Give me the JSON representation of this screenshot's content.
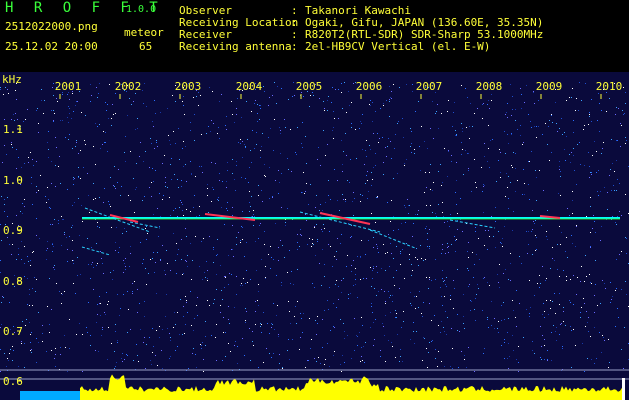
{
  "header": {
    "logo": "H R O F F T",
    "version": "1.0.0",
    "filename": "2512022000.png",
    "datetime": "25.12.02 20:00",
    "meteor_label": "meteor",
    "meteor_count": "65",
    "info": [
      {
        "label": "Observer",
        "value": "Takanori Kawachi"
      },
      {
        "label": "Receiving Location",
        "value": "Ogaki, Gifu, JAPAN (136.60E, 35.35N)"
      },
      {
        "label": "Receiver",
        "value": "R820T2(RTL-SDR) SDR-Sharp 53.1000MHz"
      },
      {
        "label": "Receiving antenna",
        "value": "2el-HB9CV Vertical (el. E-W)"
      }
    ]
  },
  "spectrogram": {
    "unit_label": "kHz",
    "time_ticks": [
      "2001",
      "2002",
      "2003",
      "2004",
      "2005",
      "2006",
      "2007",
      "2008",
      "2009",
      "2010"
    ],
    "freq_ticks": [
      "1.1",
      "1.0",
      "0.9",
      "0.8",
      "0.7",
      "0.6"
    ],
    "colors": {
      "background": "#0a0a3c",
      "trace": "#00ffff",
      "tick_text": "#ffff38",
      "bars": "#ffff00",
      "bottom_strip": "#00aaff"
    }
  }
}
